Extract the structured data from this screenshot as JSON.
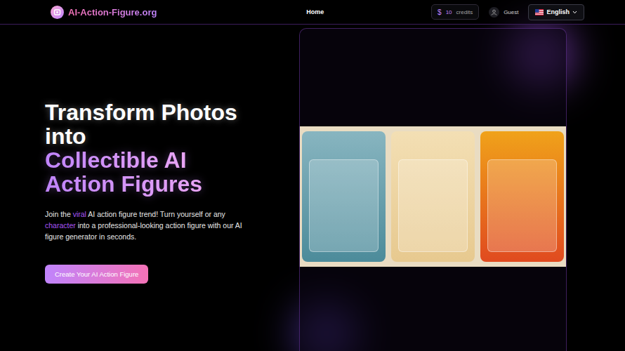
{
  "logo": {
    "text": "AI-Action-Figure.org"
  },
  "nav": [
    "Home"
  ],
  "credits": {
    "symbol": "$",
    "count": "10",
    "label": "credits"
  },
  "user": {
    "label": "Guest"
  },
  "language": {
    "label": "English"
  },
  "hero": {
    "title_lines": [
      "Transform Photos",
      "into"
    ],
    "highlight_lines": [
      "Collectible AI",
      "Action Figures"
    ],
    "description": [
      {
        "text": "Join the ",
        "accent": false
      },
      {
        "text": "viral",
        "accent": true
      },
      {
        "text": " AI action figure trend! Turn yourself or any ",
        "accent": false
      },
      {
        "text": "character",
        "accent": true
      },
      {
        "text": " into a professional-looking action figure with our AI figure generator in seconds.",
        "accent": false
      }
    ],
    "cta": "Create Your AI Action Figure"
  }
}
